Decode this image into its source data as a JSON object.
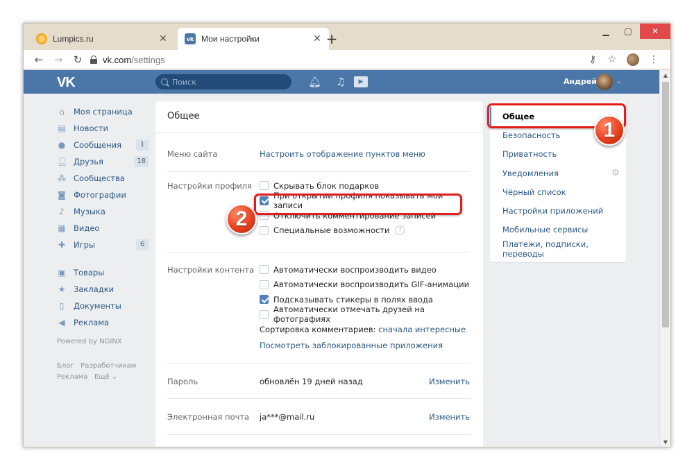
{
  "browser": {
    "tabs": [
      {
        "title": "Lumpics.ru",
        "active": false
      },
      {
        "title": "Мои настройки",
        "active": true
      }
    ],
    "address": {
      "host": "vk.com",
      "path": "/settings"
    },
    "new_tab_glyph": "+",
    "icons": {
      "back": "arrow-left-icon",
      "forward": "arrow-right-icon",
      "reload": "reload-icon",
      "key": "key-icon",
      "star": "star-icon",
      "menu": "kebab-menu-icon"
    }
  },
  "vk_header": {
    "logo": "VK",
    "search_placeholder": "Поиск",
    "user_name": "Андрей",
    "brand_color": "#4a76a8"
  },
  "left_menu": {
    "main": [
      {
        "label": "Моя страница",
        "icon": "home-icon",
        "count": null
      },
      {
        "label": "Новости",
        "icon": "news-icon",
        "count": null
      },
      {
        "label": "Сообщения",
        "icon": "chat-icon",
        "count": "1"
      },
      {
        "label": "Друзья",
        "icon": "friend-icon",
        "count": "18"
      },
      {
        "label": "Сообщества",
        "icon": "group-icon",
        "count": null
      },
      {
        "label": "Фотографии",
        "icon": "camera-icon",
        "count": null
      },
      {
        "label": "Музыка",
        "icon": "music-icon",
        "count": null
      },
      {
        "label": "Видео",
        "icon": "film-icon",
        "count": null
      },
      {
        "label": "Игры",
        "icon": "gamepad-icon",
        "count": "6"
      }
    ],
    "secondary": [
      {
        "label": "Товары",
        "icon": "bag-icon"
      },
      {
        "label": "Закладки",
        "icon": "star-icon"
      },
      {
        "label": "Документы",
        "icon": "document-icon"
      },
      {
        "label": "Реклама",
        "icon": "megaphone-icon"
      }
    ],
    "powered": "Powered by NGINX",
    "footer": {
      "blog": "Блог",
      "developers": "Разработчикам",
      "ads": "Реклама",
      "more": "Ещё"
    }
  },
  "settings": {
    "title": "Общее",
    "site_menu": {
      "label": "Меню сайта",
      "link": "Настроить отображение пунктов меню"
    },
    "profile": {
      "label": "Настройки профиля",
      "options": [
        {
          "text": "Скрывать блок подарков",
          "checked": false
        },
        {
          "text": "При открытии профиля показывать мои записи",
          "checked": true
        },
        {
          "text": "Отключить комментирование записей",
          "checked": false
        },
        {
          "text": "Специальные возможности",
          "checked": false
        }
      ],
      "help_glyph": "?"
    },
    "content": {
      "label": "Настройки контента",
      "options": [
        {
          "text": "Автоматически воспроизводить видео",
          "checked": false
        },
        {
          "text": "Автоматически воспроизводить GIF-анимации",
          "checked": false
        },
        {
          "text": "Подсказывать стикеры в полях ввода",
          "checked": true
        },
        {
          "text": "Автоматически отмечать друзей на фотографиях",
          "checked": false
        }
      ],
      "sort_label": "Сортировка комментариев:",
      "sort_value": "сначала интересные",
      "blocked_apps": "Посмотреть заблокированные приложения"
    },
    "password": {
      "label": "Пароль",
      "value": "обновлён 19 дней назад",
      "action": "Изменить"
    },
    "email": {
      "label": "Электронная почта",
      "value": "ja***@mail.ru",
      "action": "Изменить"
    }
  },
  "right_menu": [
    {
      "label": "Общее",
      "selected": true
    },
    {
      "label": "Безопасность",
      "selected": false
    },
    {
      "label": "Приватность",
      "selected": false
    },
    {
      "label": "Уведомления",
      "selected": false
    },
    {
      "label": "Чёрный список",
      "selected": false
    },
    {
      "label": "Настройки приложений",
      "selected": false
    },
    {
      "label": "Мобильные сервисы",
      "selected": false
    },
    {
      "label": "Платежи, подписки, переводы",
      "selected": false
    }
  ],
  "annotations": {
    "step1": "1",
    "step2": "2",
    "highlight_color": "#e31c1c"
  }
}
